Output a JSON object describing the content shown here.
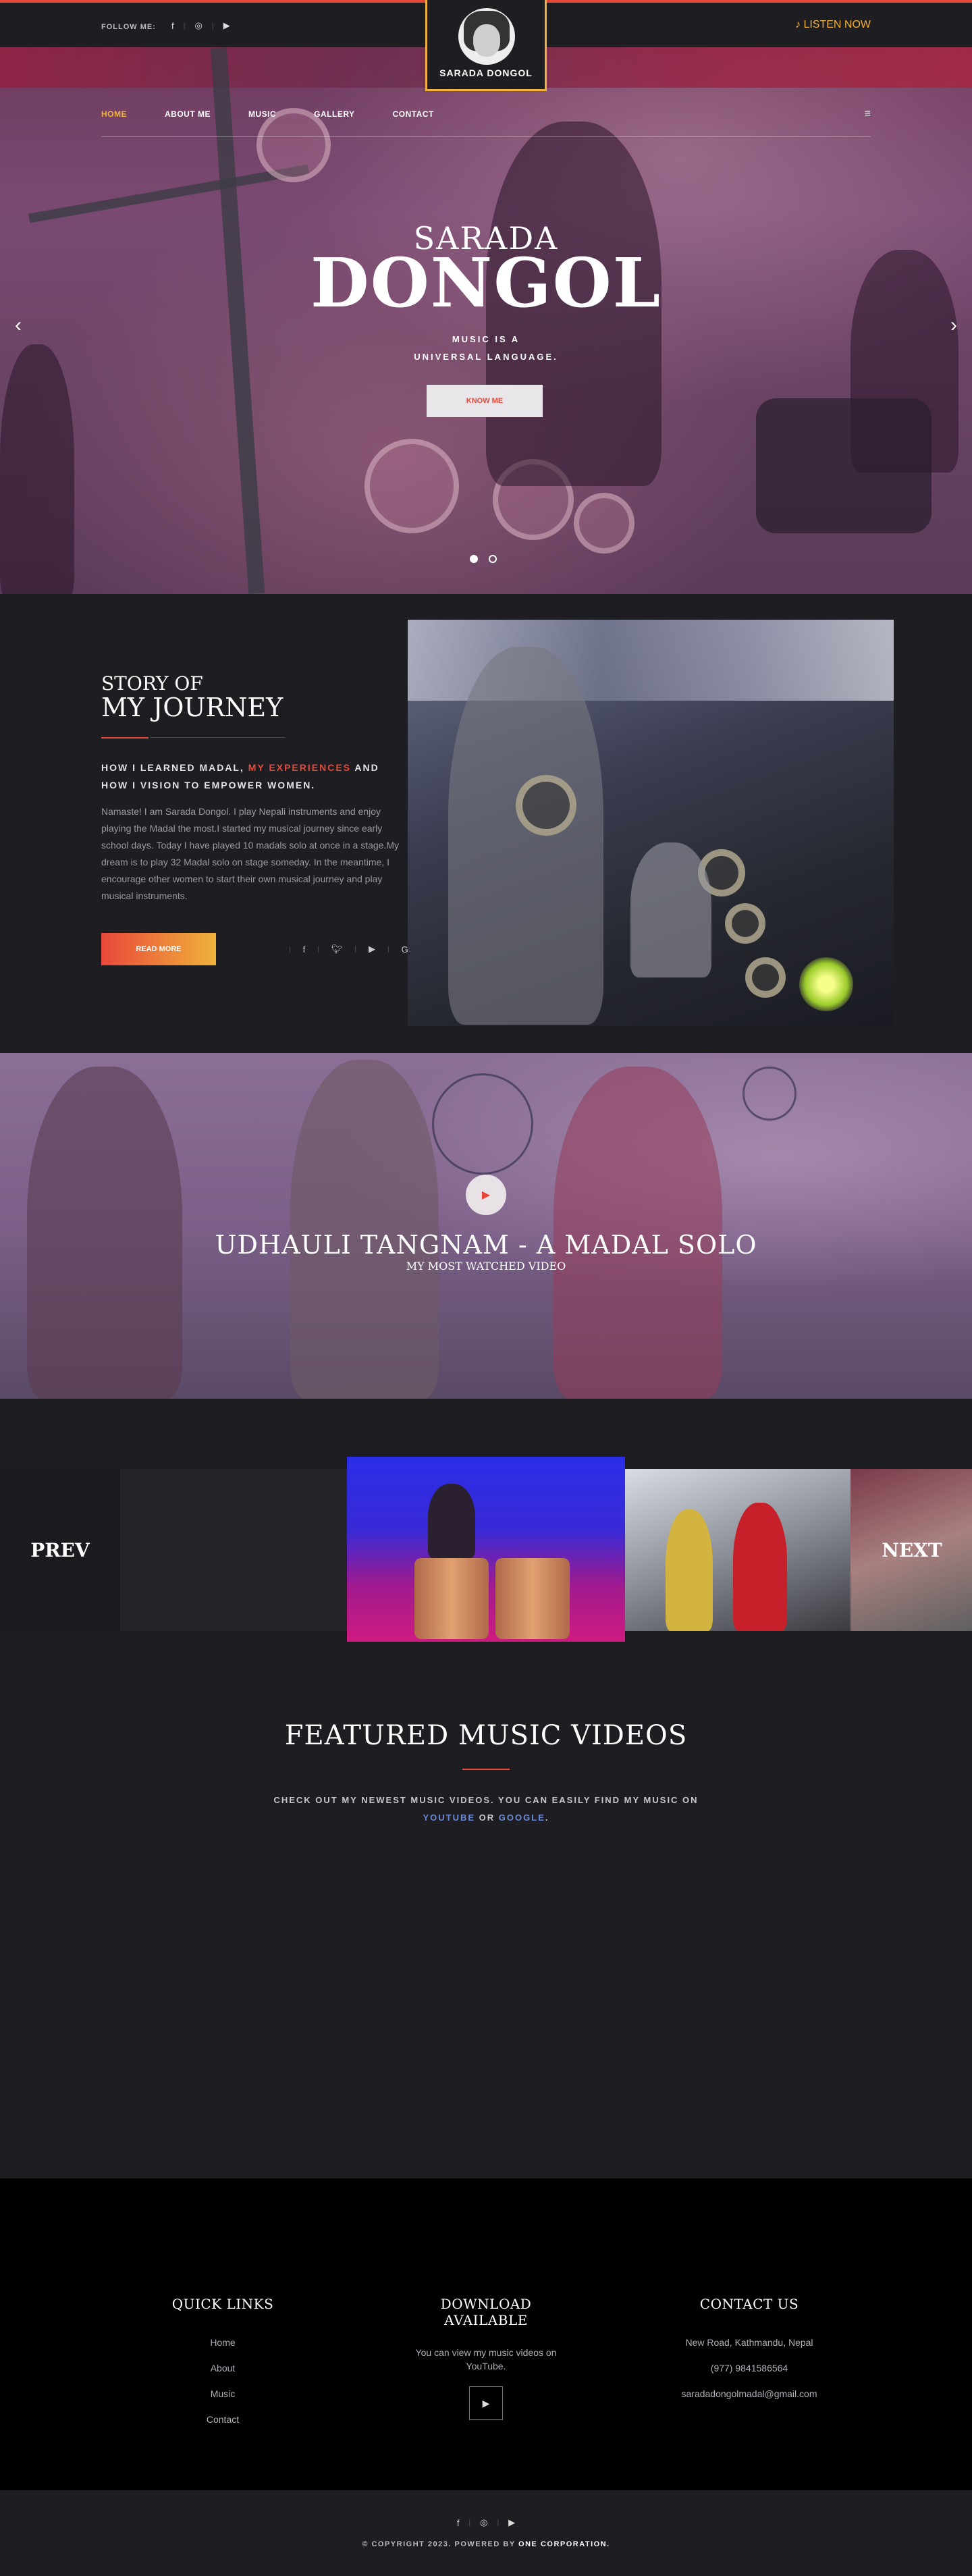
{
  "topbar": {
    "follow_label": "FOLLOW ME:",
    "social_icons": [
      "facebook-icon",
      "instagram-icon",
      "youtube-icon"
    ],
    "logo_name": "SARADA DONGOL",
    "listen_label": "LISTEN NOW",
    "accent": "#e8483a",
    "gold": "#f0b23a"
  },
  "nav": {
    "items": [
      "HOME",
      "ABOUT ME",
      "MUSIC",
      "GALLERY",
      "CONTACT"
    ],
    "active": "HOME"
  },
  "hero": {
    "title_small": "SARADA",
    "title_big": "DONGOL",
    "sub_line1": "MUSIC IS A",
    "sub_line2": "UNIVERSAL LANGUAGE.",
    "button": "KNOW ME",
    "slides": 2,
    "active_slide": 1
  },
  "story": {
    "title1": "STORY OF",
    "title2": "MY JOURNEY",
    "lead_part1": "HOW I LEARNED MADAL,",
    "lead_highlight": "MY EXPERIENCES",
    "lead_part2": "AND HOW I VISION TO EMPOWER WOMEN.",
    "body": "Namaste! I am Sarada Dongol. I play Nepali instruments and enjoy playing the Madal the most.I started my musical journey since early school days. Today I have played 10 madals solo at once in a stage.My dream is to play 32 Madal solo on stage someday. In the meantime, I encourage other women to start their own musical journey and play musical instruments.",
    "button": "READ MORE",
    "social_icons": [
      "facebook-icon",
      "twitter-icon",
      "youtube-icon",
      "google-icon"
    ]
  },
  "video_banner": {
    "title": "UDHAULI TANGNAM - A MADAL SOLO",
    "subtitle": "MY MOST WATCHED VIDEO"
  },
  "gallery": {
    "prev": "PREV",
    "next": "NEXT"
  },
  "featured": {
    "title": "FEATURED MUSIC VIDEOS",
    "desc_line1": "CHECK OUT MY NEWEST MUSIC VIDEOS. YOU CAN EASILY FIND MY MUSIC ON",
    "link1": "YOUTUBE",
    "or": " OR ",
    "link2": "GOOGLE",
    "period": "."
  },
  "footer": {
    "quick_links_title": "QUICK LINKS",
    "quick_links": [
      "Home",
      "About",
      "Music",
      "Contact"
    ],
    "download_title": "DOWNLOAD AVAILABLE",
    "download_text": "You can view my music videos on YouTube.",
    "contact_title": "CONTACT US",
    "address": "New Road, Kathmandu, Nepal",
    "phone": "(977) 9841586564",
    "email": "saradadongolmadal@gmail.com"
  },
  "bottom": {
    "copyright_prefix": "© COPYRIGHT 2023. POWERED BY",
    "copyright_brand": "ONE CORPORATION."
  }
}
